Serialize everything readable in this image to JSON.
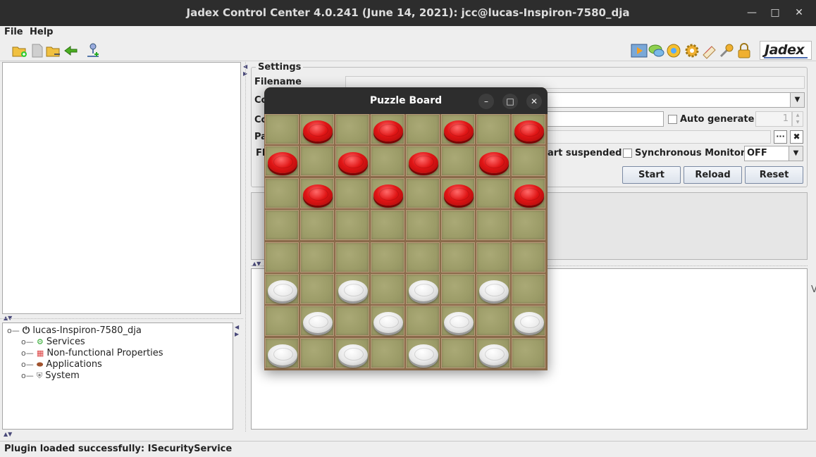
{
  "window": {
    "title": "Jadex Control Center 4.0.241 (June 14, 2021): jcc@lucas-Inspiron-7580_dja",
    "minimize_icon": "minimize-icon",
    "maximize_icon": "maximize-icon",
    "close_icon": "close-icon"
  },
  "menu": {
    "items": [
      "File",
      "Help"
    ]
  },
  "toolbar": {
    "left_icons": [
      "open-folder-icon",
      "new-file-icon",
      "folder-remove-icon",
      "back-arrow-icon",
      "add-node-icon"
    ],
    "right_icons": [
      "starter-icon",
      "chat-icon",
      "debugger-icon",
      "settings-gear-icon",
      "library-icon",
      "tools-icon",
      "security-lock-icon"
    ],
    "logo": "Jadex"
  },
  "tree": {
    "root": "lucas-Inspiron-7580_dja",
    "children": [
      "Services",
      "Non-functional Properties",
      "Applications",
      "System"
    ]
  },
  "settings": {
    "legend": "Settings",
    "filename_label": "Filename",
    "row2_label_visible": "Co",
    "row3_label_visible": "Co",
    "row4_label_visible": "Pa",
    "row5_label_visible": "Fl",
    "auto_generate_label": "Auto generate",
    "auto_generate_value": "1",
    "browse_button": "···",
    "clear_button": "✖",
    "start_suspended_partial": "art suspended",
    "synchronous_monitor_label": "Synchronous Monitor",
    "synchronous_monitor_value": "OFF",
    "start_button": "Start",
    "reload_button": "Reload",
    "reset_button": "Reset"
  },
  "puzzle": {
    "title": "Puzzle Board",
    "minimize": "–",
    "maximize": "□",
    "close": "✕",
    "rows": [
      "_r_r_r_r",
      "r_r_r_r_",
      "_r_r_r_r",
      "________",
      "________",
      "w_w_w_w_",
      "_w_w_w_w",
      "w_w_w_w_"
    ]
  },
  "status": {
    "text": "Plugin loaded successfully: ISecurityService"
  }
}
